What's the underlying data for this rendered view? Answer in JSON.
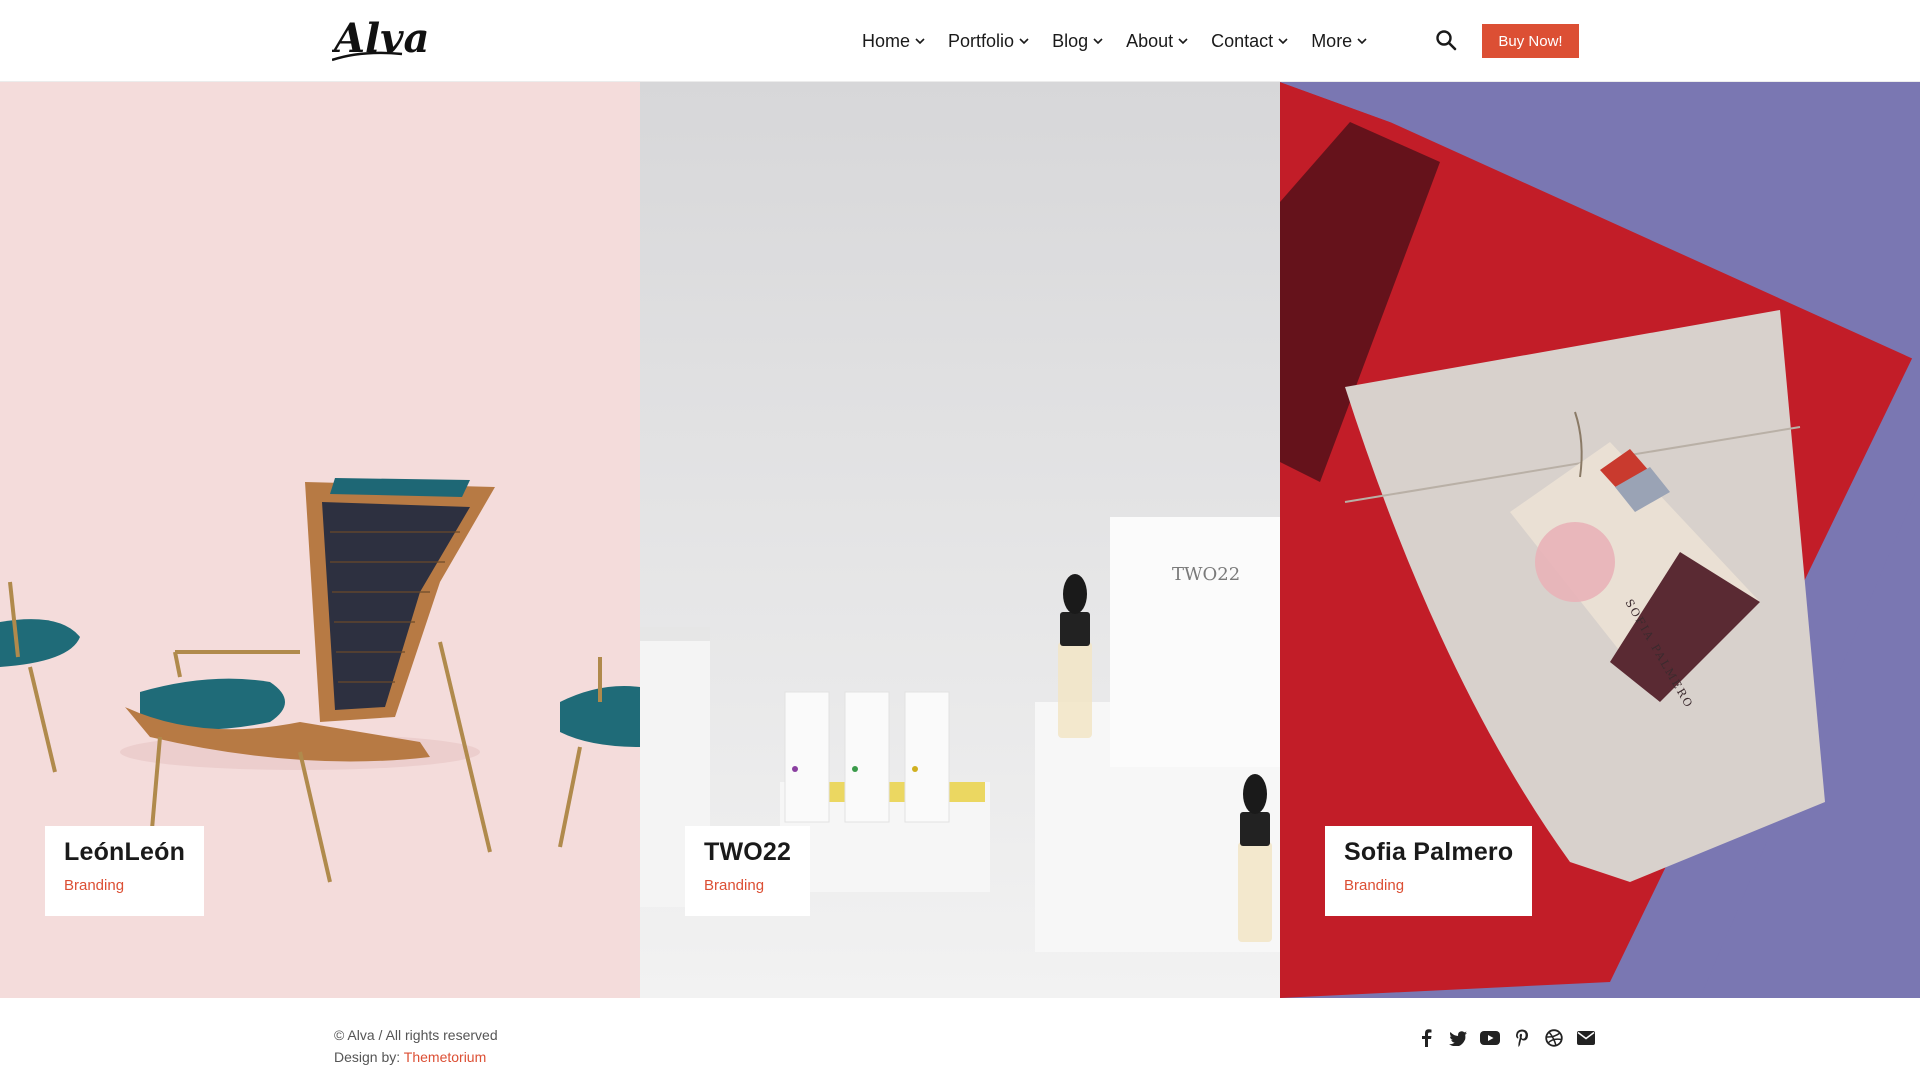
{
  "brand": {
    "logo_text": "Alva"
  },
  "nav": {
    "items": [
      {
        "label": "Home"
      },
      {
        "label": "Portfolio",
        "active": true
      },
      {
        "label": "Blog"
      },
      {
        "label": "About"
      },
      {
        "label": "Contact"
      },
      {
        "label": "More"
      }
    ],
    "search_icon": "search-icon",
    "buy_label": "Buy Now!"
  },
  "portfolio": {
    "items": [
      {
        "title": "LeónLeón",
        "category": "Branding",
        "background": "#f4dcdb"
      },
      {
        "title": "TWO22",
        "category": "Branding",
        "background": "#e1e1e3"
      },
      {
        "title": "Sofia Palmero",
        "category": "Branding",
        "background": "#7a77b2"
      }
    ]
  },
  "product_label": "TWO22",
  "tag_label": "SOFIA PALMERO",
  "footer": {
    "copyright": "© Alva / All rights reserved",
    "credit_prefix": "Design by: ",
    "credit_link": "Themetorium",
    "socials": [
      "facebook-icon",
      "twitter-icon",
      "youtube-icon",
      "pinterest-icon",
      "dribbble-icon",
      "envelope-icon"
    ]
  },
  "colors": {
    "accent": "#dc4f34",
    "text": "#1a1a1a"
  }
}
